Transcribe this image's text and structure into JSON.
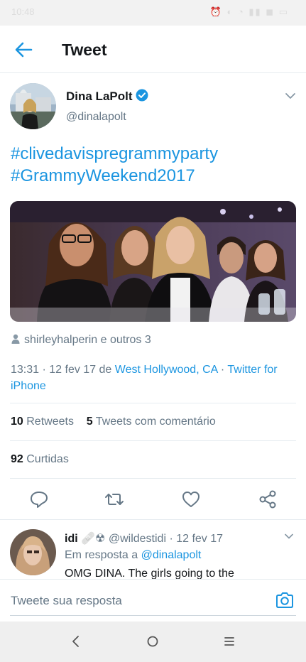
{
  "status_bar": {
    "time": "10:48",
    "icons": "⏰ ◐ ◔ ▮▮ ◼ ▭"
  },
  "header": {
    "title": "Tweet"
  },
  "tweet": {
    "author_name": "Dina LaPolt",
    "author_handle": "@dinalapolt",
    "hashtags": [
      "#clivedavispregrammyparty",
      "#GrammyWeekend2017"
    ],
    "retweeted_by": "shirleyhalperin e outros 3",
    "timestamp": "13:31 · 12 fev 17 de ",
    "location": "West Hollywood, CA",
    "source_separator": " · ",
    "source": "Twitter for iPhone",
    "retweets_count": "10",
    "retweets_label": "Retweets",
    "quote_count": "5",
    "quote_label": "Tweets com comentário",
    "likes_count": "92",
    "likes_label": "Curtidas"
  },
  "reply": {
    "name": "idi",
    "emoji": "🩹☢",
    "handle": "@wildestidi",
    "time": " · 12 fev 17",
    "in_reply_prefix": "Em resposta a ",
    "in_reply_handle": "@dinalapolt",
    "text": "OMG DINA. The girls going to the"
  },
  "composer": {
    "placeholder": "Tweete sua resposta"
  },
  "colors": {
    "accent": "#1b95e0",
    "secondary_text": "#657786",
    "primary_text": "#14171a",
    "divider": "#e6ecf0"
  },
  "icons": [
    "back-arrow-icon",
    "verified-badge-icon",
    "chevron-down-icon",
    "person-icon",
    "reply-icon",
    "retweet-icon",
    "like-icon",
    "share-icon",
    "camera-icon",
    "nav-back-icon",
    "nav-home-icon",
    "nav-menu-icon"
  ]
}
